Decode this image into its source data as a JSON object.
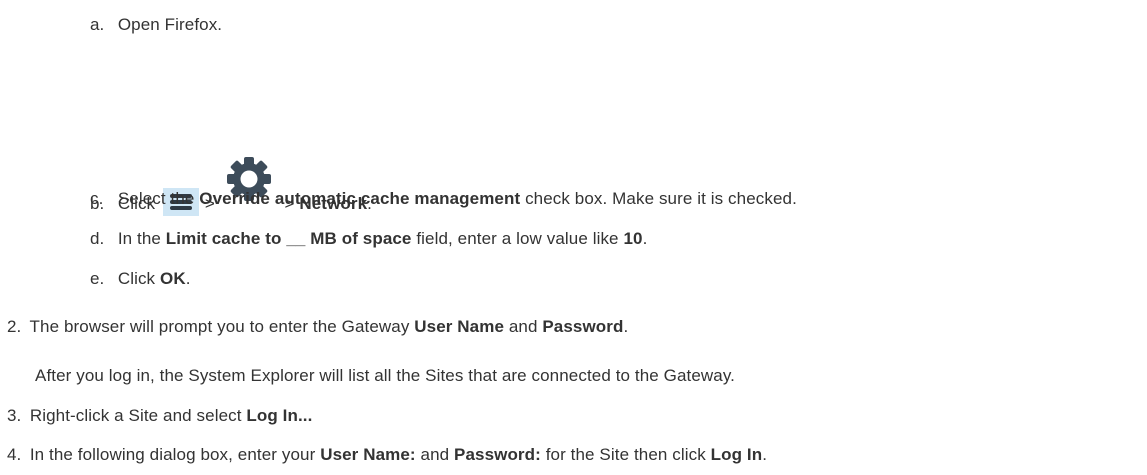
{
  "steps": {
    "a": {
      "marker": "a.",
      "text": "Open Firefox."
    },
    "b": {
      "marker": "b.",
      "pre": "Click",
      "sep1": ">",
      "sep2": ">",
      "bold": "Network",
      "post": "."
    },
    "c": {
      "marker": "c.",
      "pre": "Select the",
      "bold": "Override automatic cache management",
      "post": "check box. Make sure it is checked."
    },
    "d": {
      "marker": "d.",
      "pre": "In the",
      "bold": "Limit cache to __ MB of space",
      "mid": "field, enter a low value like",
      "bold2": "10",
      "post": "."
    },
    "e": {
      "marker": "e.",
      "pre": "Click",
      "bold": "OK",
      "post": "."
    },
    "s2": {
      "marker": "2.",
      "pre": "The browser will prompt you to enter the Gateway",
      "bold": "User Name",
      "mid": "and",
      "bold2": "Password",
      "post": "."
    },
    "s2_para": "After you log in, the System Explorer will list all the Sites that are connected to the Gateway.",
    "s3": {
      "marker": "3.",
      "pre": "Right-click a Site and select",
      "bold": "Log In..."
    },
    "s4": {
      "marker": "4.",
      "pre": "In the following dialog box, enter your",
      "bold": "User Name:",
      "mid": "and",
      "bold2": "Password:",
      "mid2": "for the Site then click",
      "bold3": "Log In",
      "post": "."
    }
  },
  "icons": {
    "menu": "hamburger-menu-icon",
    "settings": "gear-icon",
    "menu_bg_color": "#cfe6f5",
    "gear_color": "#3d4c5a"
  }
}
